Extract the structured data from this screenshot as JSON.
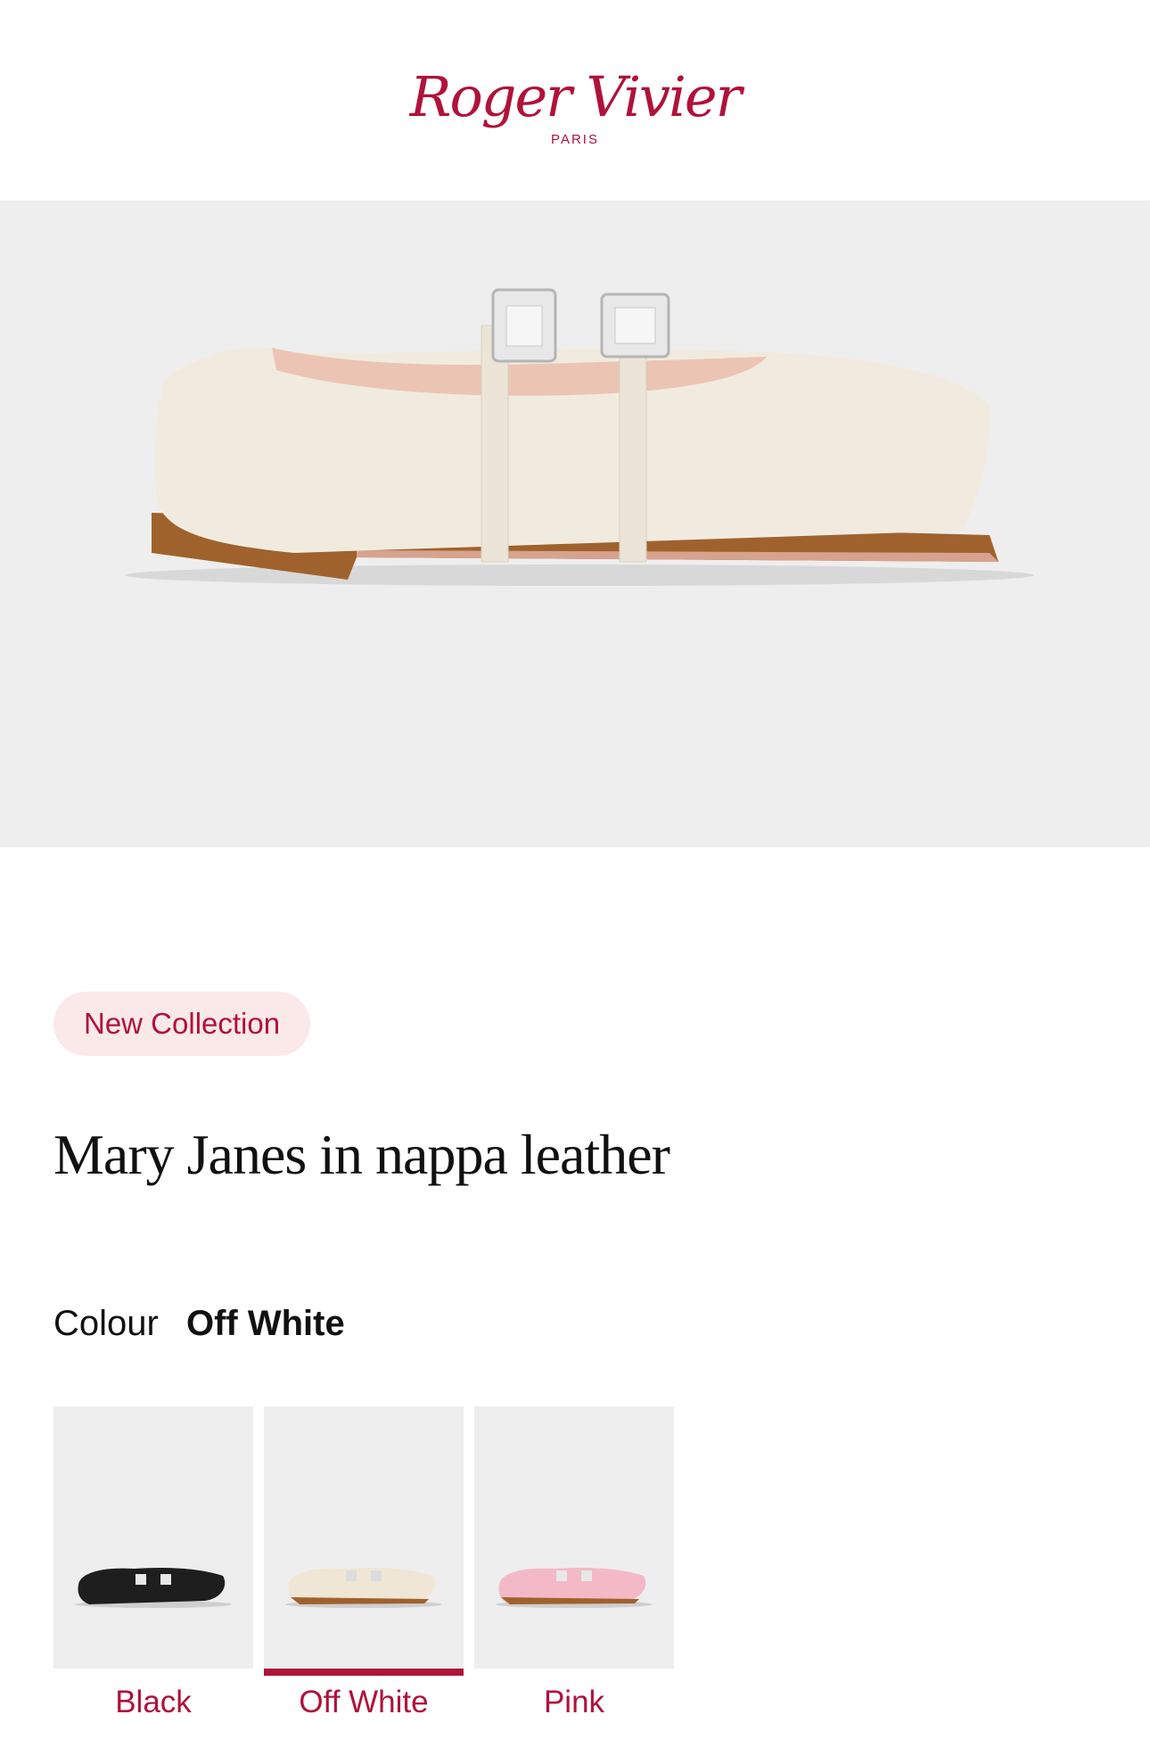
{
  "brand": {
    "name": "Roger Vivier",
    "sub": "PARIS",
    "color": "#b0123a"
  },
  "product": {
    "badge": "New Collection",
    "title": "Mary Janes in nappa leather",
    "colour_label": "Colour",
    "colour_selected": "Off White",
    "image_icon": "shoe-image"
  },
  "swatches": [
    {
      "label": "Black",
      "shoe_color": "#1e1e1e",
      "selected": false
    },
    {
      "label": "Off White",
      "shoe_color": "#efe6d6",
      "selected": true
    },
    {
      "label": "Pink",
      "shoe_color": "#f3b9c7",
      "selected": false
    }
  ]
}
